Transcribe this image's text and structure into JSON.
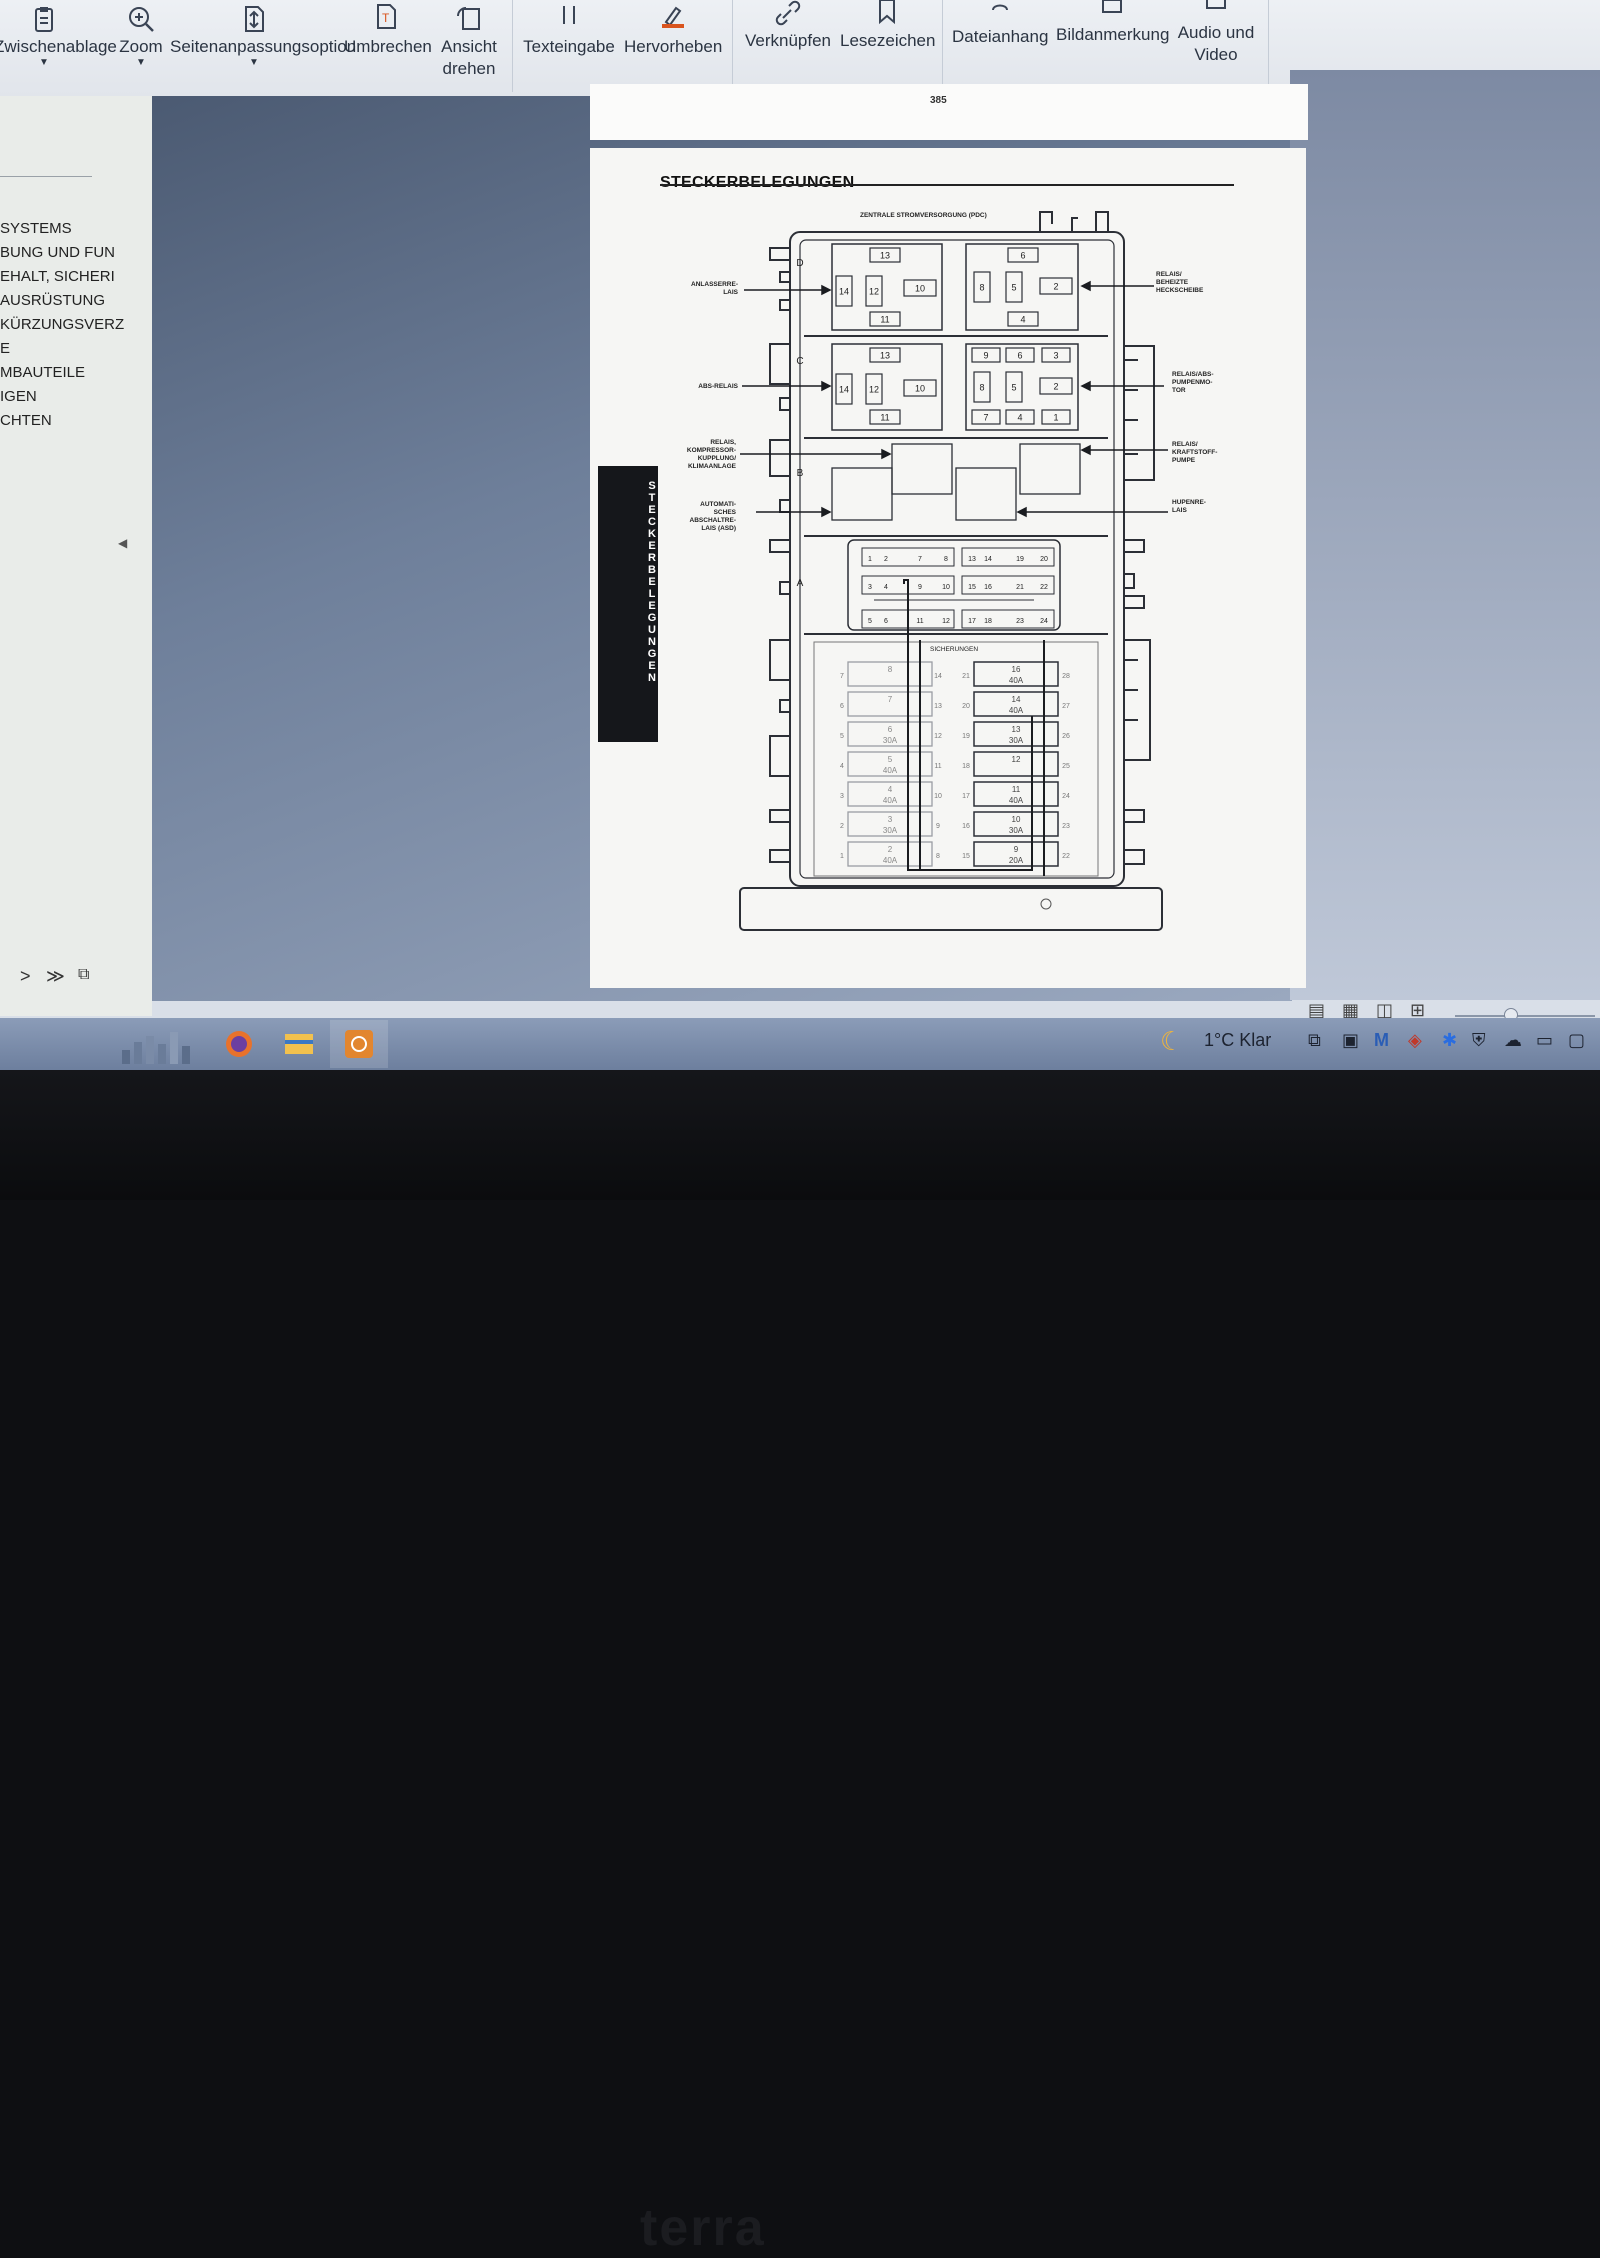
{
  "toolbar": {
    "items": [
      {
        "label": "Zwischenablage",
        "icon": "clipboard-icon",
        "dropdown": true
      },
      {
        "label": "Zoom",
        "icon": "zoom-icon",
        "dropdown": true
      },
      {
        "label": "Seitenanpassungsoption",
        "icon": "page-fit-icon",
        "dropdown": true
      },
      {
        "label": "Umbrechen",
        "icon": "reflow-icon",
        "dropdown": false
      },
      {
        "label": "Ansicht drehen",
        "icon": "rotate-view-icon",
        "dropdown": true
      },
      {
        "label": "Texteingabe",
        "icon": "text-input-icon",
        "dropdown": false
      },
      {
        "label": "Hervorheben",
        "icon": "highlight-icon",
        "dropdown": false
      },
      {
        "label": "Verknüpfen",
        "icon": "link-icon",
        "dropdown": false
      },
      {
        "label": "Lesezeichen",
        "icon": "bookmark-icon",
        "dropdown": false
      },
      {
        "label": "Dateianhang",
        "icon": "attachment-icon",
        "dropdown": false
      },
      {
        "label": "Bildanmerkung",
        "icon": "image-annotation-icon",
        "dropdown": false
      },
      {
        "label": "Audio und Video",
        "icon": "media-icon",
        "dropdown": false
      }
    ]
  },
  "sidebar": {
    "items": [
      {
        "label": "SYSTEMS"
      },
      {
        "label": "BUNG UND FUN"
      },
      {
        "label": "EHALT, SICHERI"
      },
      {
        "label": "AUSRÜSTUNG"
      },
      {
        "label": "KÜRZUNGSVERZ"
      },
      {
        "label": "E"
      },
      {
        "label": "MBAUTEILE"
      },
      {
        "label": "IGEN"
      },
      {
        "label": "CHTEN"
      }
    ],
    "nav": {
      "next": ">",
      "last": "≫"
    }
  },
  "document": {
    "page_number": "385",
    "heading": "STECKERBELEGUNGEN",
    "side_tab": "STECKERBELEGUNGEN",
    "diagram": {
      "top_label": "ZENTRALE STROMVERSORGUNG (PDC)",
      "left_labels": [
        "ANLASSERRE-\nLAIS",
        "ABS-RELAIS",
        "RELAIS,\nKOMPRESSOR-\nKUPPLUNG/\nKLIMAANLAGE",
        "AUTOMATI-\nSCHES\nABSCHALTRE-\nLAIS (ASD)"
      ],
      "right_labels": [
        "RELAIS/\nBEHEIZTE\nHECKSCHEIBE",
        "RELAIS/ABS-\nPUMPENMO-\nTOR",
        "RELAIS/\nKRAFTSTOFF-\nPUMPE",
        "HUPENRE-\nLAIS"
      ],
      "section_letters": [
        "D",
        "C",
        "B",
        "A"
      ],
      "fuse_label": "SICHERUNGEN",
      "relay_d_left": [
        "13",
        "14",
        "12",
        "10",
        "11"
      ],
      "relay_d_right": [
        "6",
        "8",
        "5",
        "2",
        "4"
      ],
      "relay_c_left": [
        "13",
        "14",
        "12",
        "10",
        "11"
      ],
      "relay_c_right": [
        "9",
        "6",
        "3",
        "8",
        "5",
        "2",
        "7",
        "4",
        "1"
      ],
      "connector_row1": [
        "1",
        "2",
        "7",
        "8",
        "13",
        "14",
        "19",
        "20"
      ],
      "connector_row2": [
        "3",
        "4",
        "9",
        "10",
        "15",
        "16",
        "21",
        "22"
      ],
      "connector_row3": [
        "5",
        "6",
        "11",
        "12",
        "17",
        "18",
        "23",
        "24"
      ],
      "fuses_left": [
        {
          "num": "8",
          "amp": ""
        },
        {
          "num": "7",
          "amp": ""
        },
        {
          "num": "6",
          "amp": "30A"
        },
        {
          "num": "5",
          "amp": "40A"
        },
        {
          "num": "4",
          "amp": "40A"
        },
        {
          "num": "3",
          "amp": "30A"
        },
        {
          "num": "2",
          "amp": "40A"
        }
      ],
      "fuses_right": [
        {
          "num": "16",
          "amp": "40A"
        },
        {
          "num": "14",
          "amp": "40A"
        },
        {
          "num": "13",
          "amp": "30A"
        },
        {
          "num": "12",
          "amp": ""
        },
        {
          "num": "11",
          "amp": "40A"
        },
        {
          "num": "10",
          "amp": "30A"
        },
        {
          "num": "9",
          "amp": "20A"
        }
      ],
      "left_col_nums": [
        "7",
        "6",
        "5",
        "4",
        "3",
        "2",
        "1"
      ],
      "mid_left_nums": [
        "14",
        "13",
        "12",
        "11",
        "10",
        "9",
        "8"
      ],
      "mid_right_nums": [
        "21",
        "20",
        "19",
        "18",
        "17",
        "16",
        "15"
      ],
      "right_col_nums": [
        "28",
        "27",
        "26",
        "25",
        "24",
        "23",
        "22"
      ]
    }
  },
  "taskbar": {
    "weather": "1°C  Klar",
    "apps": [
      "firefox-icon",
      "file-explorer-icon",
      "pdf-reader-icon"
    ]
  },
  "monitor": {
    "brand": "terra"
  },
  "colors": {
    "accent": "#d9541e",
    "doc_bg": "#f6f6f4",
    "toolbar_bg": "#e6e9ee"
  }
}
